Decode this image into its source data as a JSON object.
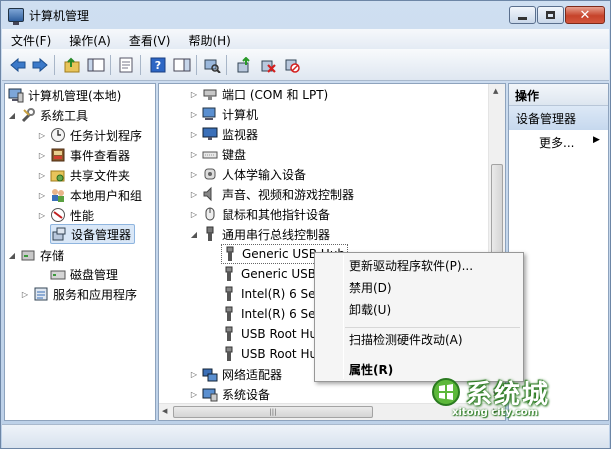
{
  "window": {
    "title": "计算机管理"
  },
  "menubar": [
    {
      "label": "文件(F)"
    },
    {
      "label": "操作(A)"
    },
    {
      "label": "查看(V)"
    },
    {
      "label": "帮助(H)"
    }
  ],
  "left_tree": [
    {
      "label": "计算机管理(本地)",
      "icon": "computer-management-icon"
    },
    {
      "label": "系统工具",
      "icon": "system-tools-icon"
    },
    {
      "label": "任务计划程序",
      "icon": "task-scheduler-icon"
    },
    {
      "label": "事件查看器",
      "icon": "event-viewer-icon"
    },
    {
      "label": "共享文件夹",
      "icon": "shared-folder-icon"
    },
    {
      "label": "本地用户和组",
      "icon": "users-icon"
    },
    {
      "label": "性能",
      "icon": "performance-icon"
    },
    {
      "label": "设备管理器",
      "icon": "device-manager-icon"
    },
    {
      "label": "存储",
      "icon": "storage-icon"
    },
    {
      "label": "磁盘管理",
      "icon": "disk-icon"
    },
    {
      "label": "服务和应用程序",
      "icon": "services-icon"
    }
  ],
  "device_tree": [
    {
      "label": "端口 (COM 和 LPT)",
      "icon": "port-icon"
    },
    {
      "label": "计算机",
      "icon": "computer-icon"
    },
    {
      "label": "监视器",
      "icon": "monitor-icon"
    },
    {
      "label": "键盘",
      "icon": "keyboard-icon"
    },
    {
      "label": "人体学输入设备",
      "icon": "hid-icon"
    },
    {
      "label": "声音、视频和游戏控制器",
      "icon": "sound-icon"
    },
    {
      "label": "鼠标和其他指针设备",
      "icon": "mouse-icon"
    },
    {
      "label": "通用串行总线控制器",
      "icon": "usb-icon"
    },
    {
      "label": "Generic USB Hub",
      "icon": "usb-device-icon"
    },
    {
      "label": "Generic USB Hub",
      "icon": "usb-device-icon"
    },
    {
      "label": "Intel(R) 6 Series",
      "icon": "usb-device-icon"
    },
    {
      "label": "Intel(R) 6 Series",
      "icon": "usb-device-icon"
    },
    {
      "label": "USB Root Hub",
      "icon": "usb-device-icon"
    },
    {
      "label": "USB Root Hub",
      "icon": "usb-device-icon"
    },
    {
      "label": "网络适配器",
      "icon": "network-icon"
    },
    {
      "label": "系统设备",
      "icon": "system-device-icon"
    }
  ],
  "actions_pane": {
    "header": "操作",
    "section": "设备管理器",
    "more": "更多..."
  },
  "context_menu": [
    {
      "label": "更新驱动程序软件(P)..."
    },
    {
      "label": "禁用(D)"
    },
    {
      "label": "卸载(U)"
    },
    {
      "label": "扫描检测硬件改动(A)"
    },
    {
      "label": "属性(R)"
    }
  ],
  "watermark": {
    "text": "系统城",
    "url": "xitong city.com"
  }
}
